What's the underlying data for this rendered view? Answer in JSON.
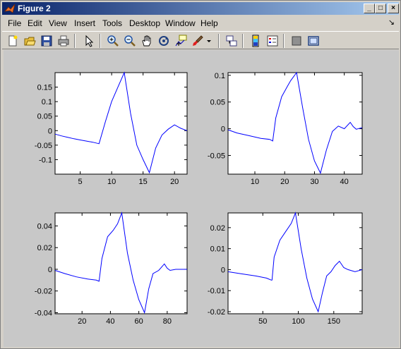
{
  "window": {
    "title": "Figure 2",
    "dock_glyph": "↘"
  },
  "menu": [
    "File",
    "Edit",
    "View",
    "Insert",
    "Tools",
    "Desktop",
    "Window",
    "Help"
  ],
  "toolbar_icons": [
    "new-figure-icon",
    "open-file-icon",
    "save-icon",
    "print-icon",
    "select-arrow-icon",
    "zoom-in-icon",
    "zoom-out-icon",
    "pan-hand-icon",
    "rotate-3d-icon",
    "data-cursor-icon",
    "brush-icon",
    "brush-dropdown-icon",
    "link-plot-icon",
    "colorbar-icon",
    "legend-icon",
    "hide-plot-tools-icon",
    "show-plot-tools-icon"
  ],
  "chart_data": [
    {
      "type": "line",
      "color": "#0000ff",
      "xlim": [
        1,
        22
      ],
      "ylim": [
        -0.15,
        0.2
      ],
      "xticks": [
        "5",
        "10",
        "15",
        "20"
      ],
      "xtick_values": [
        5,
        10,
        15,
        20
      ],
      "yticks": [
        "0.15",
        "0.1",
        "0.05",
        "0",
        "-0.05",
        "-0.1"
      ],
      "ytick_values": [
        0.15,
        0.1,
        0.05,
        0,
        -0.05,
        -0.1
      ],
      "x": [
        1,
        2,
        3,
        4,
        5,
        6,
        7,
        8,
        9,
        10,
        11,
        12,
        13,
        14,
        15,
        16,
        17,
        18,
        19,
        20,
        21,
        22
      ],
      "y": [
        -0.012,
        -0.018,
        -0.023,
        -0.028,
        -0.032,
        -0.036,
        -0.04,
        -0.045,
        0.03,
        0.1,
        0.15,
        0.2,
        0.06,
        -0.05,
        -0.1,
        -0.145,
        -0.06,
        -0.015,
        0.005,
        0.02,
        0.008,
        0.0
      ]
    },
    {
      "type": "line",
      "color": "#0000ff",
      "xlim": [
        1,
        46
      ],
      "ylim": [
        -0.085,
        0.105
      ],
      "xticks": [
        "10",
        "20",
        "30",
        "40"
      ],
      "xtick_values": [
        10,
        20,
        30,
        40
      ],
      "yticks": [
        "0.1",
        "0.05",
        "0",
        "-0.05"
      ],
      "ytick_values": [
        0.1,
        0.05,
        0,
        -0.05
      ],
      "x": [
        1,
        4,
        8,
        12,
        15,
        16,
        17,
        19,
        21,
        22,
        24,
        26,
        28,
        30,
        32,
        34,
        36,
        37,
        38,
        40,
        42,
        43,
        44,
        46
      ],
      "y": [
        -0.002,
        -0.008,
        -0.013,
        -0.018,
        -0.02,
        -0.023,
        0.02,
        0.06,
        0.08,
        0.09,
        0.105,
        0.04,
        -0.02,
        -0.06,
        -0.083,
        -0.04,
        -0.005,
        0.0,
        0.005,
        0.0,
        0.012,
        0.004,
        -0.001,
        0.002
      ]
    },
    {
      "type": "line",
      "color": "#0000ff",
      "xlim": [
        1,
        94
      ],
      "ylim": [
        -0.041,
        0.052
      ],
      "xticks": [
        "20",
        "40",
        "60",
        "80"
      ],
      "xtick_values": [
        20,
        40,
        60,
        80
      ],
      "yticks": [
        "0.04",
        "0.02",
        "0",
        "-0.02",
        "-0.04"
      ],
      "ytick_values": [
        0.04,
        0.02,
        0,
        -0.02,
        -0.04
      ],
      "x": [
        1,
        8,
        16,
        24,
        30,
        32,
        34,
        38,
        42,
        45,
        48,
        52,
        56,
        60,
        64,
        67,
        70,
        74,
        76,
        78,
        80,
        82,
        86,
        94
      ],
      "y": [
        -0.001,
        -0.004,
        -0.007,
        -0.009,
        -0.01,
        -0.011,
        0.01,
        0.03,
        0.036,
        0.042,
        0.052,
        0.015,
        -0.01,
        -0.028,
        -0.04,
        -0.018,
        -0.004,
        -0.001,
        0.002,
        0.005,
        0.001,
        -0.001,
        0.0,
        0.0
      ]
    },
    {
      "type": "line",
      "color": "#0000ff",
      "xlim": [
        1,
        190
      ],
      "ylim": [
        -0.021,
        0.027
      ],
      "xticks": [
        "50",
        "100",
        "150"
      ],
      "xtick_values": [
        50,
        100,
        150
      ],
      "yticks": [
        "0.02",
        "0.01",
        "0",
        "-0.01",
        "-0.02"
      ],
      "ytick_values": [
        0.02,
        0.01,
        0,
        -0.01,
        -0.02
      ],
      "x": [
        1,
        20,
        40,
        55,
        62,
        63,
        66,
        74,
        82,
        90,
        96,
        104,
        112,
        120,
        128,
        134,
        140,
        146,
        152,
        158,
        164,
        170,
        180,
        190
      ],
      "y": [
        -0.001,
        -0.002,
        -0.003,
        -0.004,
        -0.005,
        -0.005,
        0.006,
        0.014,
        0.018,
        0.022,
        0.027,
        0.01,
        -0.004,
        -0.014,
        -0.02,
        -0.011,
        -0.003,
        -0.001,
        0.002,
        0.004,
        0.001,
        0.0,
        -0.001,
        0.0
      ]
    }
  ]
}
